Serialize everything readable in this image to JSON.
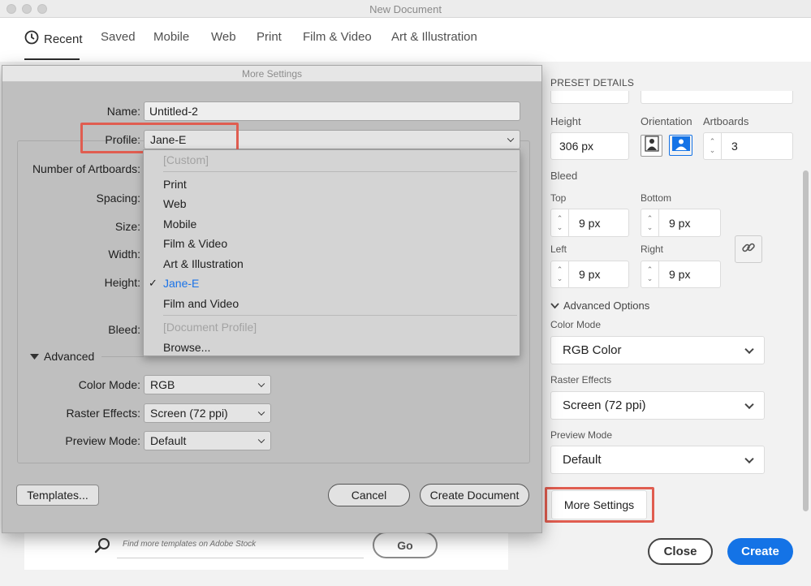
{
  "window": {
    "title": "New Document"
  },
  "tabs": [
    {
      "label": "Recent"
    },
    {
      "label": "Saved"
    },
    {
      "label": "Mobile"
    },
    {
      "label": "Web"
    },
    {
      "label": "Print"
    },
    {
      "label": "Film & Video"
    },
    {
      "label": "Art & Illustration"
    }
  ],
  "search": {
    "placeholder": "Find more templates on Adobe Stock",
    "go_label": "Go"
  },
  "preset": {
    "heading": "PRESET DETAILS",
    "height_label": "Height",
    "height_value": "306 px",
    "orientation_label": "Orientation",
    "artboards_label": "Artboards",
    "artboards_value": "3",
    "bleed_label": "Bleed",
    "top_label": "Top",
    "top_value": "9 px",
    "bottom_label": "Bottom",
    "bottom_value": "9 px",
    "left_label": "Left",
    "left_value": "9 px",
    "right_label": "Right",
    "right_value": "9 px",
    "advanced_label": "Advanced Options",
    "color_mode_label": "Color Mode",
    "color_mode_value": "RGB Color",
    "raster_label": "Raster Effects",
    "raster_value": "Screen (72 ppi)",
    "preview_label": "Preview Mode",
    "preview_value": "Default",
    "more_settings": "More Settings",
    "close": "Close",
    "create": "Create"
  },
  "dialog": {
    "title": "More Settings",
    "name_label": "Name:",
    "name_value": "Untitled-2",
    "profile_label": "Profile:",
    "profile_value": "Jane-E",
    "artboards_label": "Number of Artboards:",
    "spacing_label": "Spacing:",
    "size_label": "Size:",
    "width_label": "Width:",
    "height_label": "Height:",
    "bleed_label": "Bleed:",
    "advanced_label": "Advanced",
    "color_mode_label": "Color Mode:",
    "color_mode_value": "RGB",
    "raster_label": "Raster Effects:",
    "raster_value": "Screen (72 ppi)",
    "preview_label": "Preview Mode:",
    "preview_value": "Default",
    "templates_btn": "Templates...",
    "cancel_btn": "Cancel",
    "create_btn": "Create Document"
  },
  "profile_menu": {
    "items": [
      {
        "label": "[Custom]",
        "state": "disabled"
      },
      {
        "label": "Print",
        "state": "normal"
      },
      {
        "label": "Web",
        "state": "normal"
      },
      {
        "label": "Mobile",
        "state": "normal"
      },
      {
        "label": "Film & Video",
        "state": "normal"
      },
      {
        "label": "Art & Illustration",
        "state": "normal"
      },
      {
        "label": "Jane-E",
        "state": "selected"
      },
      {
        "label": "Film and Video",
        "state": "normal"
      },
      {
        "label": "[Document Profile]",
        "state": "disabled"
      },
      {
        "label": "Browse...",
        "state": "normal"
      }
    ],
    "check_mark": "✓"
  },
  "colors": {
    "accent": "#1473e6",
    "highlight": "#e05d50",
    "selected_text": "#1a73e8"
  }
}
